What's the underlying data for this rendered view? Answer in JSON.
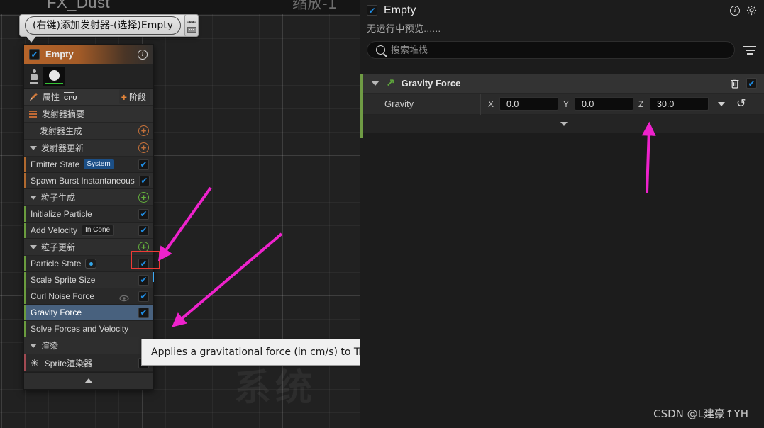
{
  "canvas": {
    "asset_title": "FX_Dust",
    "watermark_zoom": "缩放-1",
    "watermark_system": "系统"
  },
  "callout": {
    "text": "(右键)添加发射器-(选择)Empty",
    "icon_names": [
      "pin-icon",
      "keyboard-icon"
    ]
  },
  "emitter": {
    "header": {
      "title": "Empty",
      "checkbox_checked": true,
      "info_icon": "info-icon"
    },
    "thumbnail": {
      "person_icon": "person-icon",
      "preview_icon": "sprite-preview"
    },
    "attributes_row": {
      "label": "属性",
      "sim_target": "CPU",
      "stage_button": "阶段",
      "plus": "+"
    },
    "summary_row": {
      "label": "发射器摘要"
    },
    "sections": [
      {
        "id": "emitter-spawn",
        "label": "发射器生成",
        "add_color": "#c2703a",
        "collapsible": false,
        "stripe": "orange",
        "modules": []
      },
      {
        "id": "emitter-update",
        "label": "发射器更新",
        "add_color": "#c2703a",
        "collapsible": true,
        "stripe": "orange",
        "modules": [
          {
            "label": "Emitter State",
            "badge": "System",
            "badge_style": "blue",
            "enabled": true
          },
          {
            "label": "Spawn Burst Instantaneous",
            "badge": "",
            "badge_style": "",
            "enabled": true
          }
        ]
      },
      {
        "id": "particle-spawn",
        "label": "粒子生成",
        "add_color": "#63b03c",
        "collapsible": true,
        "stripe": "green",
        "modules": [
          {
            "label": "Initialize Particle",
            "badge": "",
            "badge_style": "",
            "enabled": true
          },
          {
            "label": "Add Velocity",
            "badge": "In Cone",
            "badge_style": "dark",
            "enabled": true
          }
        ]
      },
      {
        "id": "particle-update",
        "label": "粒子更新",
        "add_color": "#63b03c",
        "collapsible": true,
        "stripe": "green",
        "highlighted_add": true,
        "modules": [
          {
            "label": "Particle State",
            "badge": "dot",
            "badge_style": "dot",
            "enabled": true
          },
          {
            "label": "Scale Sprite Size",
            "badge": "",
            "badge_style": "",
            "enabled": true
          },
          {
            "label": "Curl Noise Force",
            "badge": "",
            "badge_style": "",
            "enabled": true,
            "eye": true
          },
          {
            "label": "Gravity Force",
            "badge": "",
            "badge_style": "",
            "enabled": true,
            "selected": true
          },
          {
            "label": "Solve Forces and Velocity",
            "badge": "",
            "badge_style": "",
            "enabled": false,
            "no_checkbox": true
          }
        ]
      },
      {
        "id": "render",
        "label": "渲染",
        "add_color": "",
        "collapsible": true,
        "stripe": "red",
        "modules": [
          {
            "label": "Sprite渲染器",
            "badge": "",
            "badge_style": "",
            "enabled": true,
            "icon": "star-icon"
          }
        ]
      }
    ],
    "collapse_bar_icon": "chevron-up-icon"
  },
  "tooltip": {
    "text": "Applies a gravitational force (in cm/s) to Transient.PhysicsForce"
  },
  "details": {
    "header": {
      "title": "Empty",
      "checkbox_checked": true,
      "info_icon": "info-icon",
      "gear_icon": "gear-icon"
    },
    "subtitle": "无运行中预览......",
    "search": {
      "placeholder": "搜索堆栈",
      "value": "",
      "icon": "search-icon",
      "filter_icon": "filter-icon"
    },
    "module": {
      "title": "Gravity Force",
      "enabled": true,
      "caret_icon": "chevron-down-icon",
      "type_icon": "arrow-up-right-icon",
      "delete_icon": "trash-icon",
      "property": {
        "label": "Gravity",
        "axes": [
          {
            "axis": "X",
            "value": "0.0"
          },
          {
            "axis": "Y",
            "value": "0.0"
          },
          {
            "axis": "Z",
            "value": "30.0"
          }
        ],
        "dropdown_icon": "chevron-down-icon",
        "reset_icon": "revert-icon"
      },
      "footer_icon": "chevron-down-icon"
    }
  },
  "credit": "CSDN @L建豪↑YH",
  "colors": {
    "accent_orange": "#c2703a",
    "accent_green": "#63b03c",
    "selection_blue": "#48617e",
    "checkbox_blue": "#1f8fe8",
    "highlight_red": "#ef3b36",
    "arrow_magenta": "#ee22cc"
  }
}
